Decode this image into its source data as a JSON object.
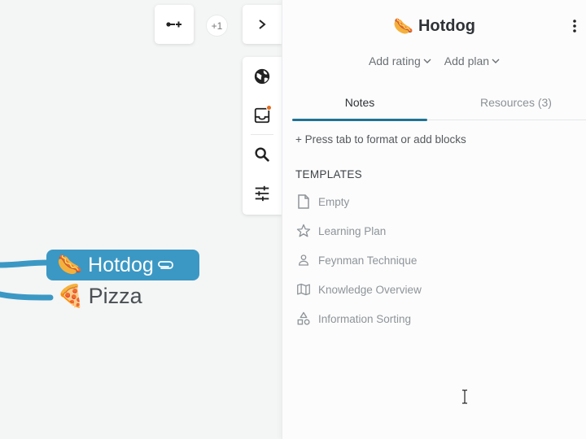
{
  "canvas": {
    "count_badge": "+1",
    "nodes": {
      "hotdog": {
        "label": "Hotdog",
        "emoji": "🌭",
        "icon": "paperclip-icon",
        "color": "#3b98c4"
      },
      "pizza": {
        "label": "Pizza",
        "emoji": "🍕"
      }
    },
    "toolbar": [
      {
        "icon": "globe-icon"
      },
      {
        "icon": "inbox-icon",
        "badge_color": "#e56b1f"
      },
      {
        "icon": "search-icon"
      },
      {
        "icon": "sliders-icon"
      }
    ],
    "buttons": {
      "add_branch": "add-branch-icon",
      "expand": "chevron-right-icon"
    }
  },
  "panel": {
    "title": "Hotdog",
    "title_emoji": "🌭",
    "add_rating": "Add rating",
    "add_plan": "Add plan",
    "tabs": [
      {
        "label": "Notes",
        "active": true
      },
      {
        "label": "Resources (3)",
        "active": false
      }
    ],
    "hint": "+ Press tab to format or add blocks",
    "templates_heading": "TEMPLATES",
    "templates": [
      {
        "label": "Empty",
        "icon": "document-icon"
      },
      {
        "label": "Learning Plan",
        "icon": "star-icon"
      },
      {
        "label": "Feynman Technique",
        "icon": "person-icon"
      },
      {
        "label": "Knowledge Overview",
        "icon": "map-icon"
      },
      {
        "label": "Information Sorting",
        "icon": "shapes-icon"
      }
    ],
    "accent": "#1f7394"
  }
}
